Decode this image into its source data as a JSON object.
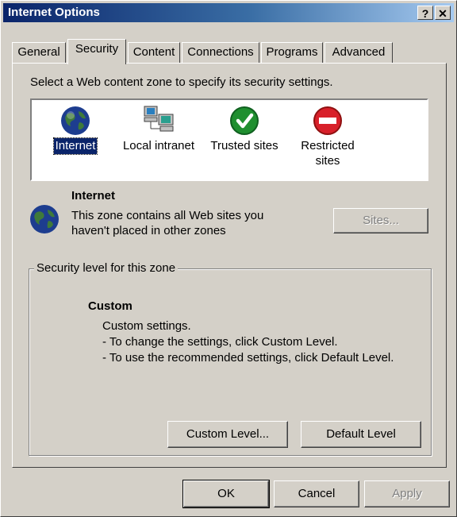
{
  "window": {
    "title": "Internet Options",
    "help_btn": "?",
    "close_btn": "✕"
  },
  "tabs": [
    {
      "label": "General"
    },
    {
      "label": "Security",
      "active": true
    },
    {
      "label": "Content"
    },
    {
      "label": "Connections"
    },
    {
      "label": "Programs"
    },
    {
      "label": "Advanced"
    }
  ],
  "security": {
    "instruction": "Select a Web content zone to specify its security settings.",
    "zones": [
      {
        "label": "Internet",
        "icon": "globe-icon",
        "selected": true
      },
      {
        "label": "Local intranet",
        "icon": "network-computers-icon"
      },
      {
        "label": "Trusted sites",
        "icon": "green-check-icon"
      },
      {
        "label_line1": "Restricted",
        "label_line2": "sites",
        "icon": "red-no-entry-icon"
      }
    ],
    "zone_info": {
      "name": "Internet",
      "desc_line1": "This zone contains all Web sites you",
      "desc_line2": "haven't placed in other zones",
      "sites_btn": "Sites..."
    },
    "level_group": {
      "label": "Security level for this zone",
      "level_name": "Custom",
      "line1": "Custom settings.",
      "line2": "- To change the settings, click Custom Level.",
      "line3": "- To use the recommended settings, click Default Level.",
      "custom_btn": "Custom Level...",
      "default_btn": "Default Level"
    }
  },
  "footer": {
    "ok": "OK",
    "cancel": "Cancel",
    "apply": "Apply"
  },
  "colors": {
    "title_bar": "#0a246a",
    "face": "#d4d0c8",
    "selection": "#0a246a"
  }
}
